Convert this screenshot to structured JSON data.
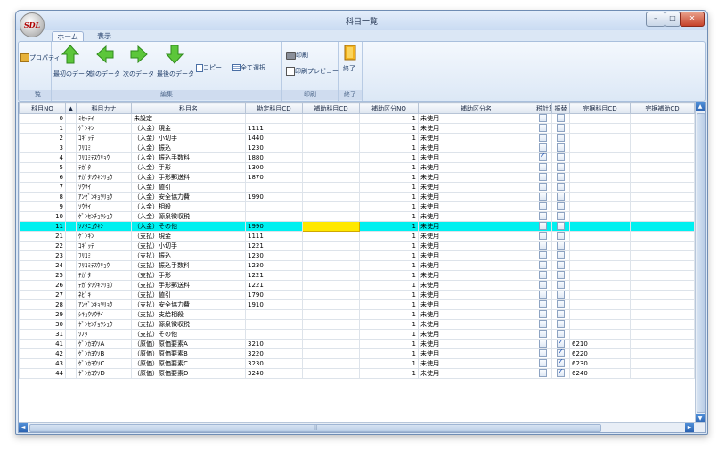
{
  "window": {
    "title": "科目一覧",
    "app_logo": "SDL",
    "controls": {
      "minimize": "–",
      "maximize": "□",
      "close": "✕"
    }
  },
  "tabs": [
    {
      "label": "ホーム",
      "active": true
    },
    {
      "label": "表示",
      "active": false
    }
  ],
  "ribbon": {
    "groups": [
      {
        "name": "一覧",
        "buttons": [
          {
            "label": "プロパティ",
            "icon": "properties-icon"
          }
        ]
      },
      {
        "name": "編集",
        "buttons": [
          {
            "label": "最初のデータ",
            "icon": "arrow-up-icon"
          },
          {
            "label": "前のデータ",
            "icon": "arrow-left-icon"
          },
          {
            "label": "次のデータ",
            "icon": "arrow-right-icon"
          },
          {
            "label": "最後のデータ",
            "icon": "arrow-down-icon"
          },
          {
            "label": "コピー",
            "icon": "copy-icon"
          },
          {
            "label": "全て選択",
            "icon": "select-all-icon"
          }
        ]
      },
      {
        "name": "印刷",
        "buttons": [
          {
            "label": "印刷",
            "icon": "printer-icon"
          },
          {
            "label": "印刷プレビュー",
            "icon": "print-preview-icon"
          }
        ]
      },
      {
        "name": "終了",
        "buttons": [
          {
            "label": "終了",
            "icon": "exit-door-icon"
          }
        ]
      }
    ]
  },
  "grid": {
    "sort_indicator": "▲",
    "columns": [
      "科目NO",
      "科目カナ",
      "科目名",
      "勘定科目CD",
      "補助科目CD",
      "補助区分NO",
      "補助区分名",
      "税計算",
      "振替",
      "完据科目CD",
      "完据補助CD"
    ],
    "rows": [
      {
        "no": "0",
        "kana": "ﾐｾｯﾃｲ",
        "name": "未設定",
        "cd": "",
        "hojo": "",
        "kubun": "1",
        "kname": "未使用",
        "tax": false,
        "furi": false,
        "k1": "",
        "k2": ""
      },
      {
        "no": "1",
        "kana": "ｹﾞﾝｷﾝ",
        "name": "（入金）現金",
        "cd": "1111",
        "hojo": "",
        "kubun": "1",
        "kname": "未使用",
        "tax": false,
        "furi": false,
        "k1": "",
        "k2": ""
      },
      {
        "no": "2",
        "kana": "ｺｷﾞｯﾃ",
        "name": "（入金）小切手",
        "cd": "1440",
        "hojo": "",
        "kubun": "1",
        "kname": "未使用",
        "tax": false,
        "furi": false,
        "k1": "",
        "k2": ""
      },
      {
        "no": "3",
        "kana": "ﾌﾘｺﾐ",
        "name": "（入金）振込",
        "cd": "1230",
        "hojo": "",
        "kubun": "1",
        "kname": "未使用",
        "tax": false,
        "furi": false,
        "k1": "",
        "k2": ""
      },
      {
        "no": "4",
        "kana": "ﾌﾘｺﾐﾃｽｳﾘｮｳ",
        "name": "（入金）振込手数料",
        "cd": "1880",
        "hojo": "",
        "kubun": "1",
        "kname": "未使用",
        "tax": true,
        "furi": false,
        "k1": "",
        "k2": ""
      },
      {
        "no": "5",
        "kana": "ﾃｶﾞﾀ",
        "name": "（入金）手形",
        "cd": "1300",
        "hojo": "",
        "kubun": "1",
        "kname": "未使用",
        "tax": false,
        "furi": false,
        "k1": "",
        "k2": ""
      },
      {
        "no": "6",
        "kana": "ﾃｶﾞﾀｿｳｷﾝﾘｮｳ",
        "name": "（入金）手形郵送料",
        "cd": "1870",
        "hojo": "",
        "kubun": "1",
        "kname": "未使用",
        "tax": false,
        "furi": false,
        "k1": "",
        "k2": ""
      },
      {
        "no": "7",
        "kana": "ｿｳｻｲ",
        "name": "（入金）値引",
        "cd": "",
        "hojo": "",
        "kubun": "1",
        "kname": "未使用",
        "tax": false,
        "furi": false,
        "k1": "",
        "k2": ""
      },
      {
        "no": "8",
        "kana": "ｱﾝｾﾞﾝｷｮｳﾘｮｸ",
        "name": "（入金）安全協力費",
        "cd": "1990",
        "hojo": "",
        "kubun": "1",
        "kname": "未使用",
        "tax": false,
        "furi": false,
        "k1": "",
        "k2": ""
      },
      {
        "no": "9",
        "kana": "ｿｳｻｲ",
        "name": "（入金）相殺",
        "cd": "",
        "hojo": "",
        "kubun": "1",
        "kname": "未使用",
        "tax": false,
        "furi": false,
        "k1": "",
        "k2": ""
      },
      {
        "no": "10",
        "kana": "ｹﾞﾝｾﾝﾁｮｳｼｭｳ",
        "name": "（入金）源泉徴収税",
        "cd": "",
        "hojo": "",
        "kubun": "1",
        "kname": "未使用",
        "tax": false,
        "furi": false,
        "k1": "",
        "k2": ""
      },
      {
        "no": "11",
        "kana": "ｿﾉﾀﾆｭｳｷﾝ",
        "name": "（入金）その他",
        "cd": "1990",
        "hojo": "",
        "kubun": "1",
        "kname": "未使用",
        "tax": false,
        "furi": false,
        "k1": "",
        "k2": "",
        "selected": true
      },
      {
        "no": "21",
        "kana": "ｹﾞﾝｷﾝ",
        "name": "（支払）現金",
        "cd": "1111",
        "hojo": "",
        "kubun": "1",
        "kname": "未使用",
        "tax": false,
        "furi": false,
        "k1": "",
        "k2": ""
      },
      {
        "no": "22",
        "kana": "ｺｷﾞｯﾃ",
        "name": "（支払）小切手",
        "cd": "1221",
        "hojo": "",
        "kubun": "1",
        "kname": "未使用",
        "tax": false,
        "furi": false,
        "k1": "",
        "k2": ""
      },
      {
        "no": "23",
        "kana": "ﾌﾘｺﾐ",
        "name": "（支払）振込",
        "cd": "1230",
        "hojo": "",
        "kubun": "1",
        "kname": "未使用",
        "tax": false,
        "furi": false,
        "k1": "",
        "k2": ""
      },
      {
        "no": "24",
        "kana": "ﾌﾘｺﾐﾃｽｳﾘｮｳ",
        "name": "（支払）振込手数料",
        "cd": "1230",
        "hojo": "",
        "kubun": "1",
        "kname": "未使用",
        "tax": false,
        "furi": false,
        "k1": "",
        "k2": ""
      },
      {
        "no": "25",
        "kana": "ﾃｶﾞﾀ",
        "name": "（支払）手形",
        "cd": "1221",
        "hojo": "",
        "kubun": "1",
        "kname": "未使用",
        "tax": false,
        "furi": false,
        "k1": "",
        "k2": ""
      },
      {
        "no": "26",
        "kana": "ﾃｶﾞﾀｿｳｷﾝﾘｮｳ",
        "name": "（支払）手形郵送料",
        "cd": "1221",
        "hojo": "",
        "kubun": "1",
        "kname": "未使用",
        "tax": false,
        "furi": false,
        "k1": "",
        "k2": ""
      },
      {
        "no": "27",
        "kana": "ﾈﾋﾞｷ",
        "name": "（支払）値引",
        "cd": "1790",
        "hojo": "",
        "kubun": "1",
        "kname": "未使用",
        "tax": false,
        "furi": false,
        "k1": "",
        "k2": ""
      },
      {
        "no": "28",
        "kana": "ｱﾝｾﾞﾝｷｮｳﾘｮｸ",
        "name": "（支払）安全協力費",
        "cd": "1910",
        "hojo": "",
        "kubun": "1",
        "kname": "未使用",
        "tax": false,
        "furi": false,
        "k1": "",
        "k2": ""
      },
      {
        "no": "29",
        "kana": "ｼｷｭｳｿｳｻｲ",
        "name": "（支払）支給相殺",
        "cd": "",
        "hojo": "",
        "kubun": "1",
        "kname": "未使用",
        "tax": false,
        "furi": false,
        "k1": "",
        "k2": ""
      },
      {
        "no": "30",
        "kana": "ｹﾞﾝｾﾝﾁｮｳｼｭｳ",
        "name": "（支払）源泉徴収税",
        "cd": "",
        "hojo": "",
        "kubun": "1",
        "kname": "未使用",
        "tax": false,
        "furi": false,
        "k1": "",
        "k2": ""
      },
      {
        "no": "31",
        "kana": "ｿﾉﾀ",
        "name": "（支払）その他",
        "cd": "",
        "hojo": "",
        "kubun": "1",
        "kname": "未使用",
        "tax": false,
        "furi": false,
        "k1": "",
        "k2": ""
      },
      {
        "no": "41",
        "kana": "ｹﾞﾝｶﾖｳｿA",
        "name": "（原価）原価要素A",
        "cd": "3210",
        "hojo": "",
        "kubun": "1",
        "kname": "未使用",
        "tax": false,
        "furi": true,
        "k1": "6210",
        "k2": ""
      },
      {
        "no": "42",
        "kana": "ｹﾞﾝｶﾖｳｿB",
        "name": "（原価）原価要素B",
        "cd": "3220",
        "hojo": "",
        "kubun": "1",
        "kname": "未使用",
        "tax": false,
        "furi": true,
        "k1": "6220",
        "k2": ""
      },
      {
        "no": "43",
        "kana": "ｹﾞﾝｶﾖｳｿC",
        "name": "（原価）原価要素C",
        "cd": "3230",
        "hojo": "",
        "kubun": "1",
        "kname": "未使用",
        "tax": false,
        "furi": true,
        "k1": "6230",
        "k2": ""
      },
      {
        "no": "44",
        "kana": "ｹﾞﾝｶﾖｳｿD",
        "name": "（原価）原価要素D",
        "cd": "3240",
        "hojo": "",
        "kubun": "1",
        "kname": "未使用",
        "tax": false,
        "furi": true,
        "k1": "6240",
        "k2": ""
      }
    ]
  },
  "scroll": {
    "up": "▲",
    "down": "▼",
    "left": "◄",
    "right": "►",
    "grip": "|||"
  }
}
